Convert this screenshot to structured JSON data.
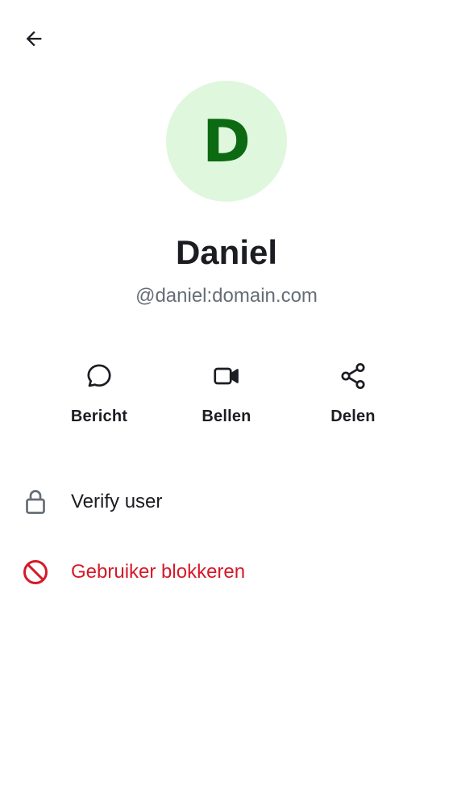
{
  "header": {
    "back_icon": "arrow-left-icon"
  },
  "profile": {
    "avatar_letter": "D",
    "avatar_bg": "#dff7dc",
    "avatar_fg": "#0b6a12",
    "display_name": "Daniel",
    "user_id": "@daniel:domain.com"
  },
  "actions": [
    {
      "label": "Bericht",
      "icon": "chat-bubble-icon"
    },
    {
      "label": "Bellen",
      "icon": "video-camera-icon"
    },
    {
      "label": "Delen",
      "icon": "share-icon"
    }
  ],
  "list": {
    "verify": {
      "label": "Verify user",
      "icon": "lock-icon"
    },
    "block": {
      "label": "Gebruiker blokkeren",
      "icon": "block-icon",
      "color": "#d51928"
    }
  },
  "colors": {
    "text_primary": "#1b1d22",
    "text_secondary": "#656d77",
    "critical": "#d51928"
  }
}
